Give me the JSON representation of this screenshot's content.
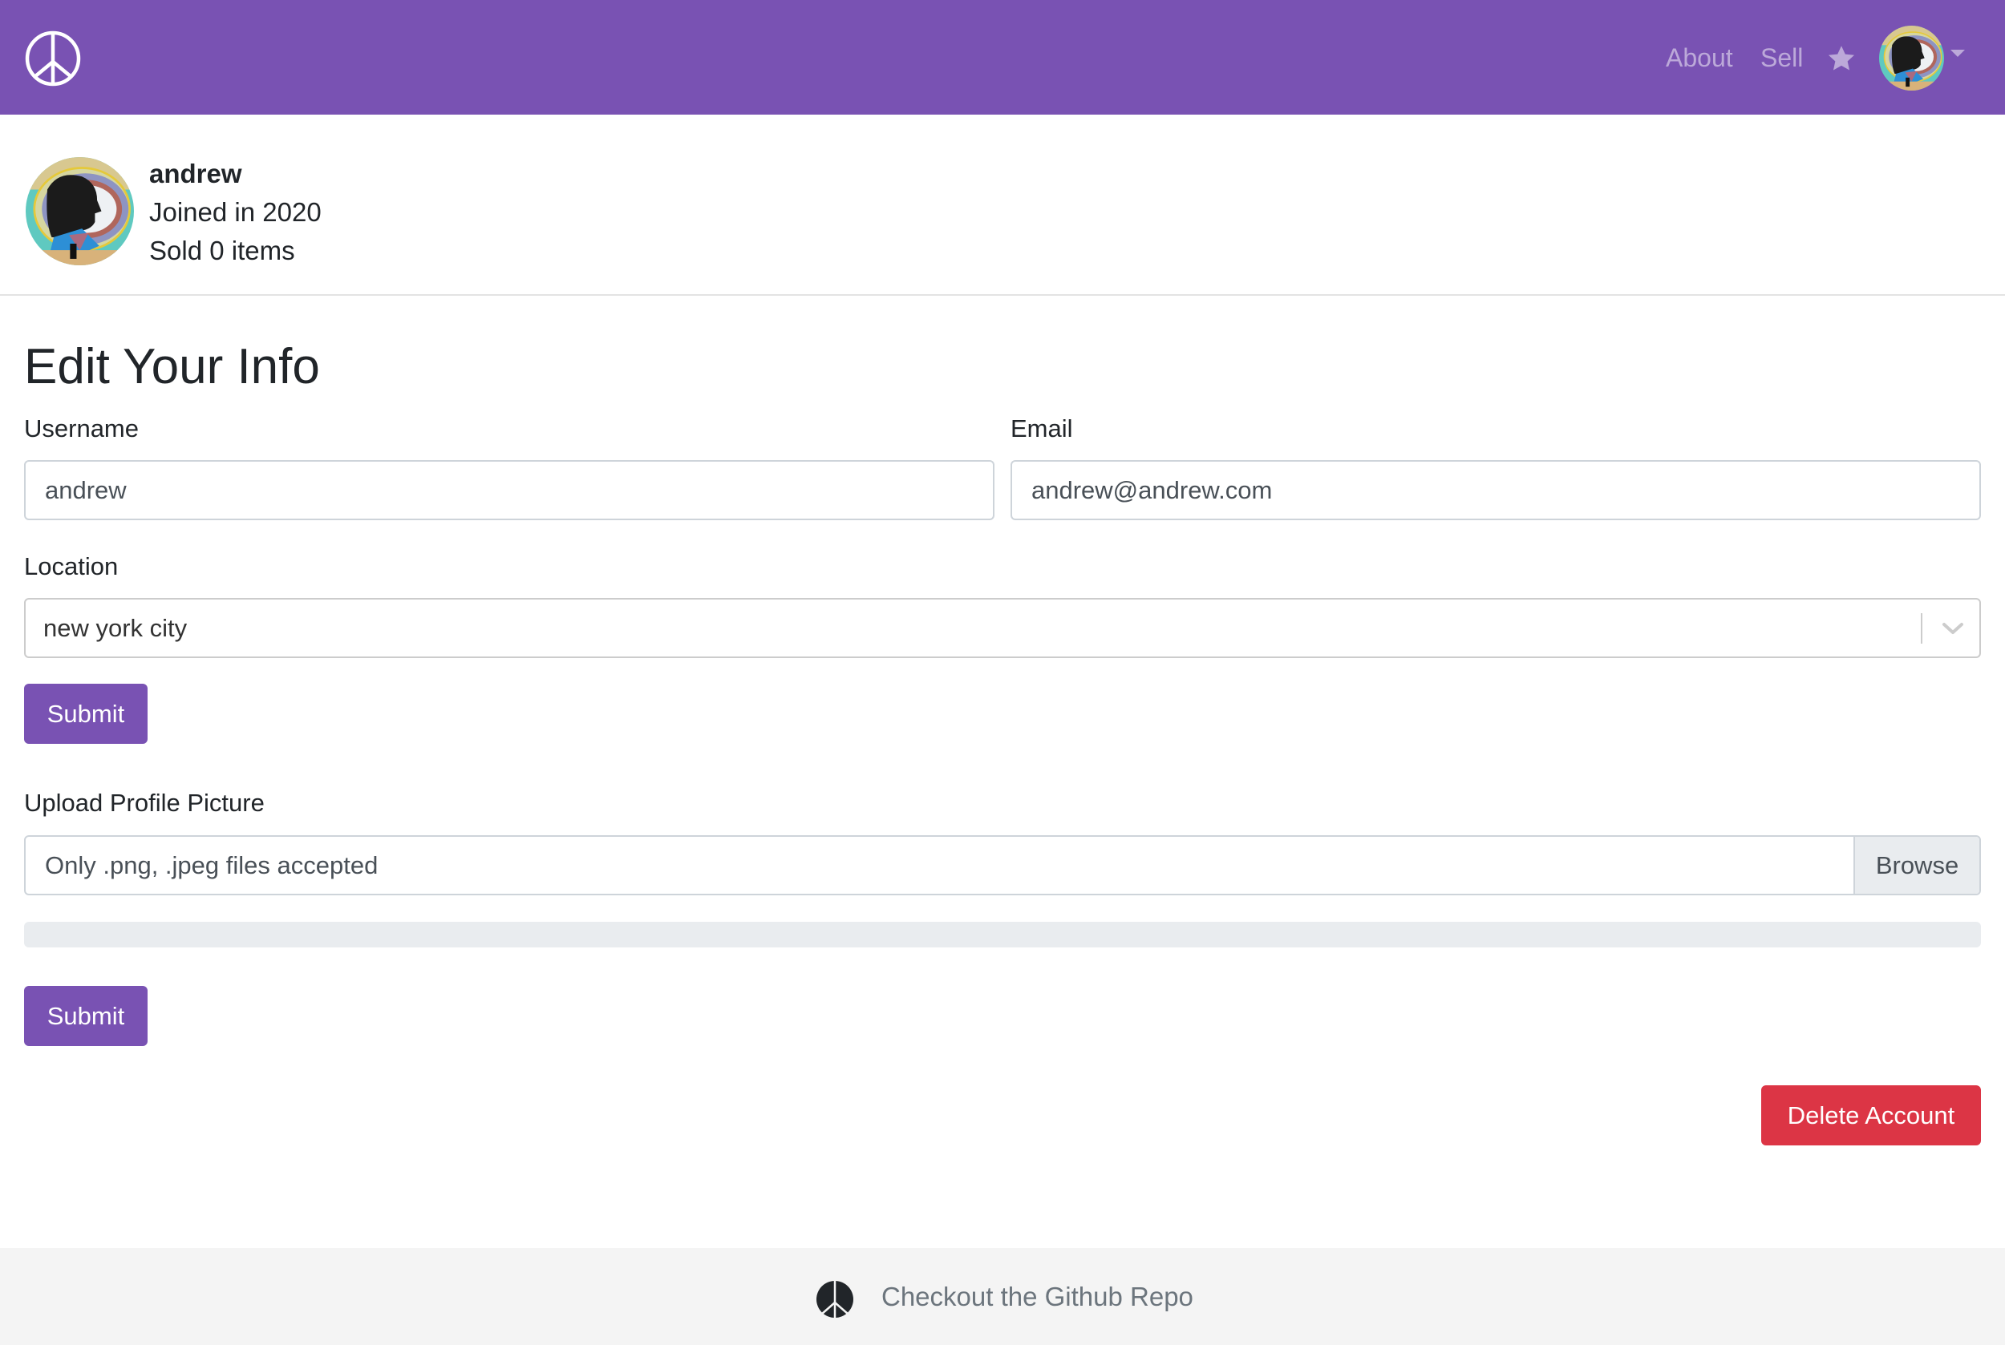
{
  "navbar": {
    "brand_icon": "peace-sign-icon",
    "links": [
      {
        "label": "About"
      },
      {
        "label": "Sell"
      }
    ],
    "favorites_icon": "star-icon",
    "user_menu_icon": "caret-down-icon",
    "brand_color": "#7952b3"
  },
  "profile": {
    "username": "andrew",
    "joined": "Joined in 2020",
    "sold": "Sold 0 items"
  },
  "form": {
    "title": "Edit Your Info",
    "username": {
      "label": "Username",
      "value": "andrew"
    },
    "email": {
      "label": "Email",
      "value": "andrew@andrew.com"
    },
    "location": {
      "label": "Location",
      "value": "new york city"
    },
    "submit_label": "Submit"
  },
  "upload": {
    "label": "Upload Profile Picture",
    "placeholder": "Only .png, .jpeg files accepted",
    "browse_label": "Browse",
    "progress_percent": 0,
    "submit_label": "Submit"
  },
  "danger": {
    "delete_label": "Delete Account",
    "color": "#dc3545"
  },
  "footer": {
    "icon": "peace-sign-icon",
    "link_label": "Checkout the Github Repo"
  }
}
